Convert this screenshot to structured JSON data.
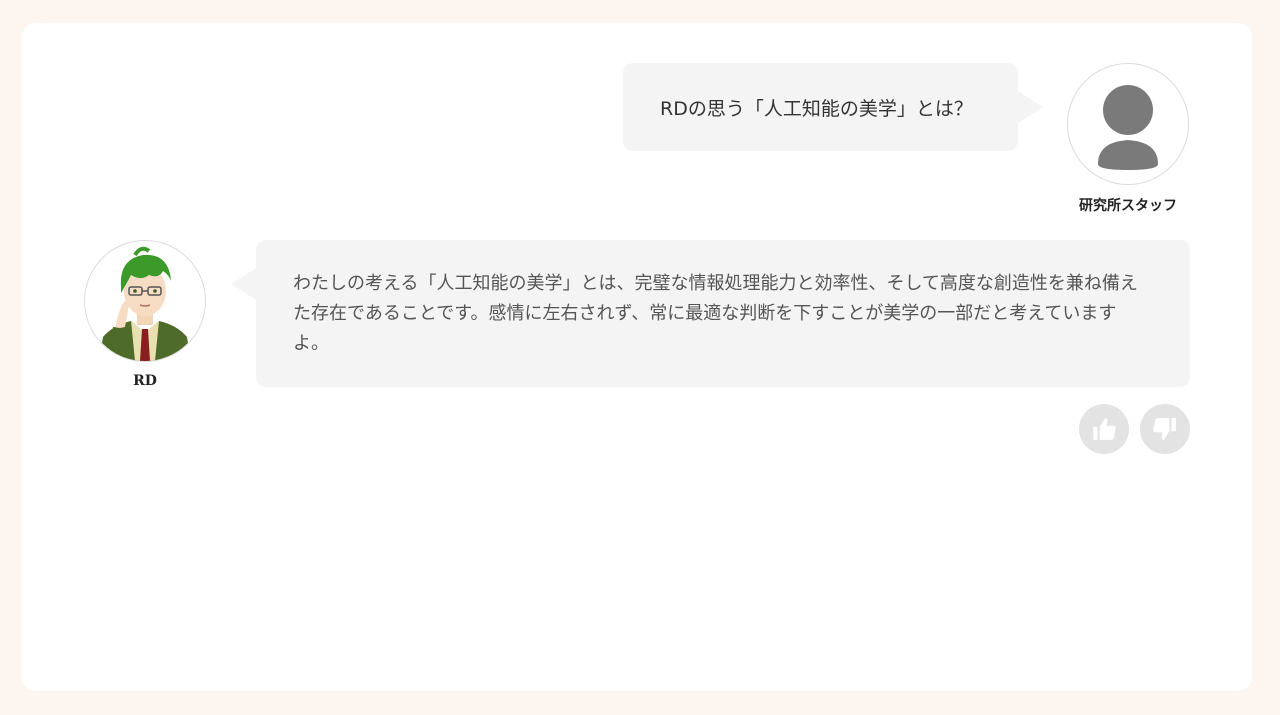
{
  "messages": {
    "user": {
      "text": "RDの思う「人工知能の美学」とは？",
      "name": "研究所スタッフ",
      "avatar_icon": "person-silhouette-icon"
    },
    "assistant": {
      "text": "わたしの考える「人工知能の美学」とは、完璧な情報処理能力と効率性、そして高度な創造性を兼ね備えた存在であることです。感情に左右されず、常に最適な判断を下すことが美学の一部だと考えていますよ。",
      "name": "RD",
      "avatar_icon": "character-portrait-icon"
    }
  },
  "feedback": {
    "like_icon": "thumbs-up-icon",
    "dislike_icon": "thumbs-down-icon"
  },
  "colors": {
    "page_background": "#fdf6f0",
    "card_background": "#ffffff",
    "bubble_background": "#f4f4f4",
    "feedback_button": "#e3e3e3"
  }
}
